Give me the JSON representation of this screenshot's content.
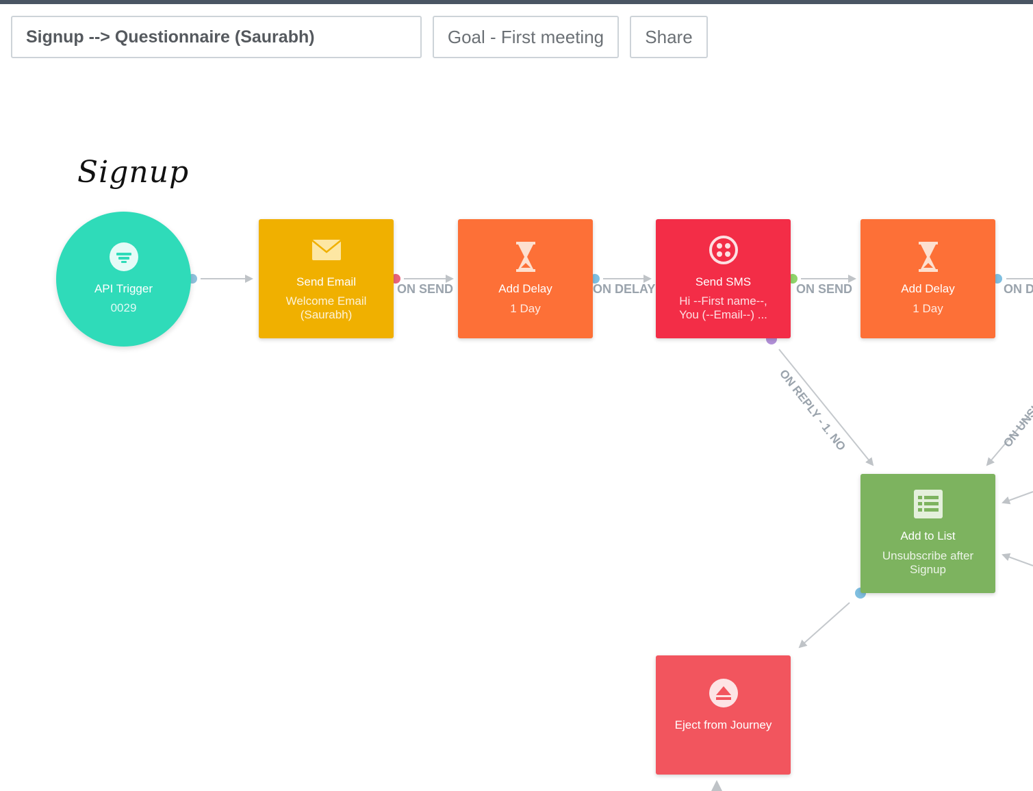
{
  "header": {
    "journey_name": "Signup --> Questionnaire (Saurabh)",
    "goal_label": "Goal - First meeting",
    "share_label": "Share"
  },
  "annotation": {
    "text": "Signup"
  },
  "nodes": {
    "trigger": {
      "title": "API Trigger",
      "sub": "0029",
      "color": "#2fdbb9",
      "icon": "api-trigger-icon"
    },
    "send_email": {
      "title": "Send Email",
      "sub": "Welcome Email (Saurabh)",
      "color": "#f0b000",
      "icon": "envelope-icon"
    },
    "delay1": {
      "title": "Add Delay",
      "sub": "1 Day",
      "color": "#fd7037",
      "icon": "hourglass-icon"
    },
    "send_sms": {
      "title": "Send SMS",
      "sub": "Hi --First name--, You (--Email--) ...",
      "color": "#f32d47",
      "icon": "sms-icon"
    },
    "delay2": {
      "title": "Add Delay",
      "sub": "1 Day",
      "color": "#fd7037",
      "icon": "hourglass-icon"
    },
    "add_list": {
      "title": "Add to List",
      "sub": "Unsubscribe after Signup",
      "color": "#7db35f",
      "icon": "list-icon"
    },
    "eject": {
      "title": "Eject from Journey",
      "color": "#f2555e",
      "icon": "eject-icon"
    }
  },
  "edge_labels": {
    "on_send_1": "ON SEND",
    "on_delay": "ON DELAY",
    "on_send_2": "ON SEND",
    "on_d_partial": "ON D",
    "on_reply": "ON REPLY - 1. NO",
    "on_unsub_partial": "ON UNSUB"
  }
}
